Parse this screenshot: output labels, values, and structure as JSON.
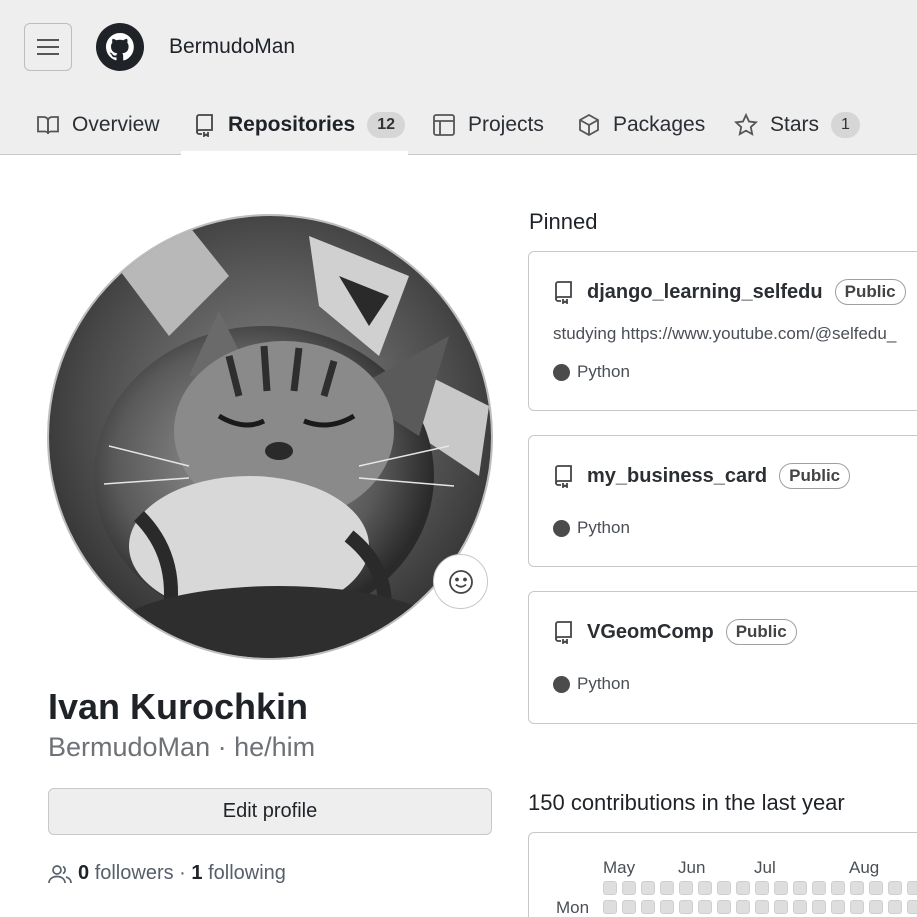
{
  "header": {
    "username": "BermudoMan",
    "menu_icon": "hamburger-icon",
    "logo_icon": "github-logo"
  },
  "tabs": [
    {
      "label": "Overview",
      "icon": "book-icon"
    },
    {
      "label": "Repositories",
      "icon": "repo-icon",
      "count": "12",
      "active": true
    },
    {
      "label": "Projects",
      "icon": "table-icon"
    },
    {
      "label": "Packages",
      "icon": "package-icon"
    },
    {
      "label": "Stars",
      "icon": "star-icon",
      "count": "1"
    }
  ],
  "profile": {
    "full_name": "Ivan Kurochkin",
    "login_pronouns": "BermudoMan · he/him",
    "edit_button": "Edit profile",
    "followers_count": "0",
    "followers_label": "followers",
    "separator": "·",
    "following_count": "1",
    "following_label": "following",
    "avatar_desc": "sleeping tabby kitten",
    "status_icon": "smiley-icon"
  },
  "pinned": {
    "title": "Pinned",
    "repos": [
      {
        "name": "django_learning_selfedu",
        "visibility": "Public",
        "description": "studying https://www.youtube.com/@selfedu_",
        "language": "Python"
      },
      {
        "name": "my_business_card",
        "visibility": "Public",
        "description": "",
        "language": "Python"
      },
      {
        "name": "VGeomComp",
        "visibility": "Public",
        "description": "",
        "language": "Python"
      }
    ]
  },
  "contributions": {
    "title": "150 contributions in the last year",
    "months": [
      "May",
      "Jun",
      "Jul",
      "Aug"
    ],
    "day_label": "Mon"
  },
  "colors": {
    "header_bg": "#eeeeee",
    "lang_dot": "#4b4b4b",
    "cell_empty": "#dedede"
  }
}
